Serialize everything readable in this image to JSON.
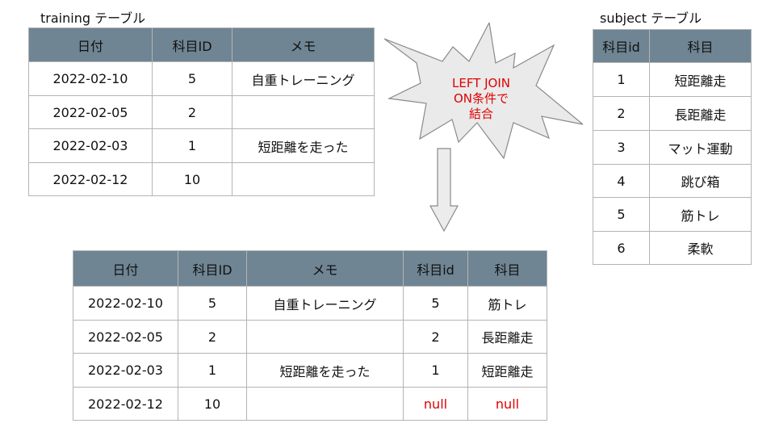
{
  "training": {
    "caption": "training テーブル",
    "headers": [
      "日付",
      "科目ID",
      "メモ"
    ],
    "rows": [
      [
        "2022-02-10",
        "5",
        "自重トレーニング"
      ],
      [
        "2022-02-05",
        "2",
        ""
      ],
      [
        "2022-02-03",
        "1",
        "短距離を走った"
      ],
      [
        "2022-02-12",
        "10",
        ""
      ]
    ]
  },
  "subject": {
    "caption": "subject テーブル",
    "headers": [
      "科目id",
      "科目"
    ],
    "rows": [
      [
        "1",
        "短距離走"
      ],
      [
        "2",
        "長距離走"
      ],
      [
        "3",
        "マット運動"
      ],
      [
        "4",
        "跳び箱"
      ],
      [
        "5",
        "筋トレ"
      ],
      [
        "6",
        "柔軟"
      ]
    ]
  },
  "burst": {
    "line1": "LEFT JOIN",
    "line2": "ON条件で",
    "line3": "結合",
    "text_color": "#e00000"
  },
  "result": {
    "headers": [
      "日付",
      "科目ID",
      "メモ",
      "科目id",
      "科目"
    ],
    "rows": [
      [
        "2022-02-10",
        "5",
        "自重トレーニング",
        "5",
        "筋トレ"
      ],
      [
        "2022-02-05",
        "2",
        "",
        "2",
        "長距離走"
      ],
      [
        "2022-02-03",
        "1",
        "短距離を走った",
        "1",
        "短距離走"
      ],
      [
        "2022-02-12",
        "10",
        "",
        "null",
        "null"
      ]
    ]
  },
  "colors": {
    "header_fill": "#6f8593",
    "border": "#b4b4b4",
    "null_text": "#e00000"
  }
}
